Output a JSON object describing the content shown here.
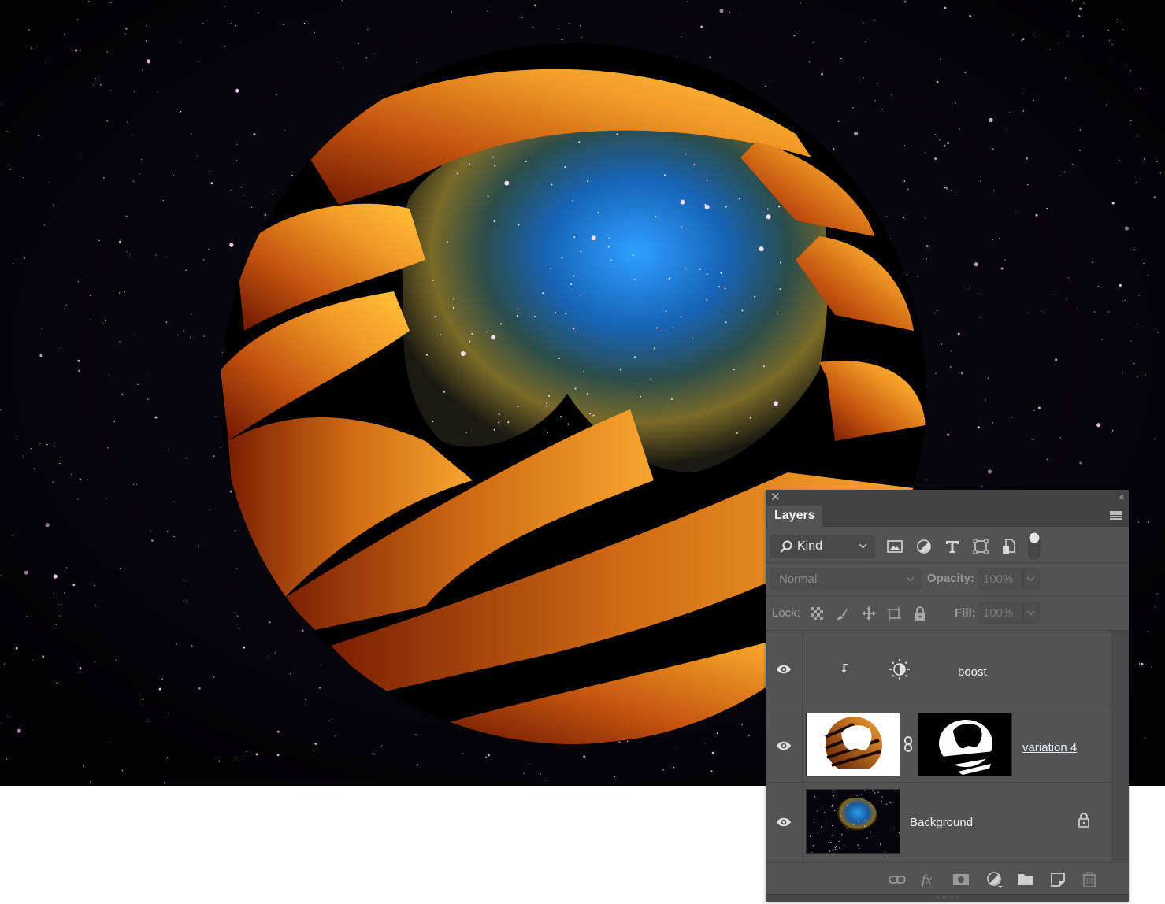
{
  "app": "Adobe Photoshop",
  "canvas": {
    "description": "Orange striped ribbon sphere wrapped around a nebula cut-out on a starfield",
    "colors": {
      "space": "#030104",
      "ribbon_light": "#f7b02e",
      "ribbon_dark": "#6a1a02",
      "nebula_blue": "#1a7fe0",
      "nebula_gold": "#b59a3a",
      "star": "#f2c9f2"
    }
  },
  "panel": {
    "close_icon": "close-icon",
    "collapse_label": "‹‹",
    "tab_label": "Layers",
    "menu_icon": "panel-menu-icon",
    "filter": {
      "kind_label": "Kind",
      "icons": [
        "pixel-layer-filter-icon",
        "adjustment-layer-filter-icon",
        "type-layer-filter-icon",
        "shape-layer-filter-icon",
        "smart-object-filter-icon",
        "filter-toggle-icon"
      ]
    },
    "blend_mode": "Normal",
    "opacity_label": "Opacity:",
    "opacity_value": "100%",
    "lock_label": "Lock:",
    "lock_icons": [
      "lock-transparent-pixels-icon",
      "lock-image-pixels-icon",
      "lock-position-icon",
      "lock-artboard-icon",
      "lock-all-icon"
    ],
    "fill_label": "Fill:",
    "fill_value": "100%",
    "layers": [
      {
        "name": "boost",
        "type": "adjustment",
        "visible": true,
        "clipped": true,
        "adjustment_icon": "brightness-contrast-icon"
      },
      {
        "name": "variation 4",
        "type": "pixel",
        "visible": true,
        "has_mask": true,
        "linked_mask": true
      },
      {
        "name": "Background",
        "type": "background",
        "visible": true,
        "locked": true
      }
    ],
    "bottom_icons": [
      "link-layers-icon",
      "layer-style-fx-icon",
      "add-mask-icon",
      "new-fill-adjustment-icon",
      "new-group-icon",
      "new-layer-icon",
      "delete-layer-icon"
    ]
  }
}
